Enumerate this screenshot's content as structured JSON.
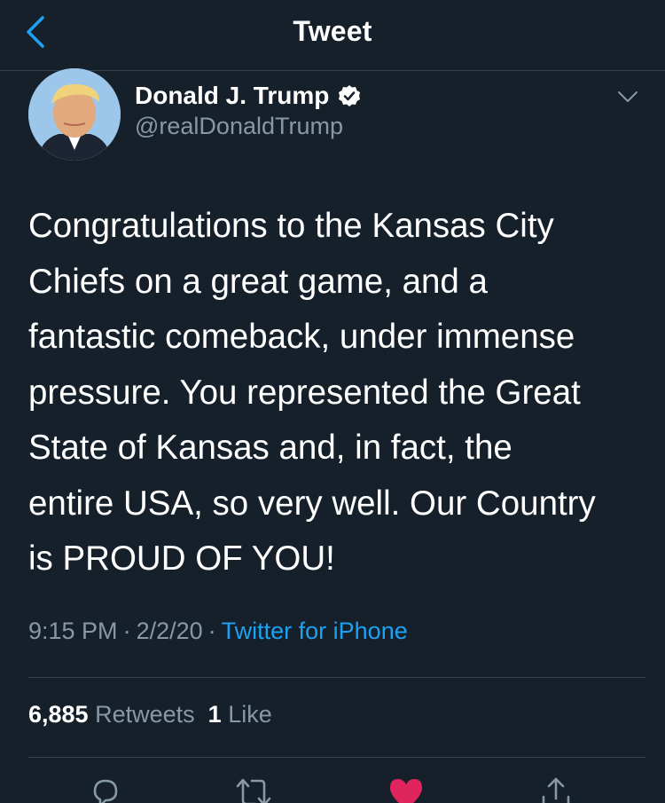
{
  "nav": {
    "title": "Tweet"
  },
  "author": {
    "name": "Donald J. Trump",
    "handle": "@realDonaldTrump",
    "verified": true
  },
  "tweet": {
    "lines": [
      "Congratulations to the Kansas City",
      "Chiefs on a great game, and a",
      "fantastic comeback, under immense",
      "pressure. You represented the Great",
      "State of Kansas and, in fact, the",
      "entire USA, so very well. Our Country",
      "is PROUD OF YOU!"
    ],
    "time": "9:15 PM",
    "date": "2/2/20",
    "source": "Twitter for iPhone"
  },
  "stats": {
    "retweets_count": "6,885",
    "retweets_label": "Retweets",
    "likes_count": "1",
    "likes_label": "Like"
  },
  "actions": {
    "liked": true
  },
  "colors": {
    "background": "#15202b",
    "accent": "#1da1f2",
    "secondary_text": "#8899a6",
    "divider": "#38444d",
    "like": "#e0245e"
  }
}
